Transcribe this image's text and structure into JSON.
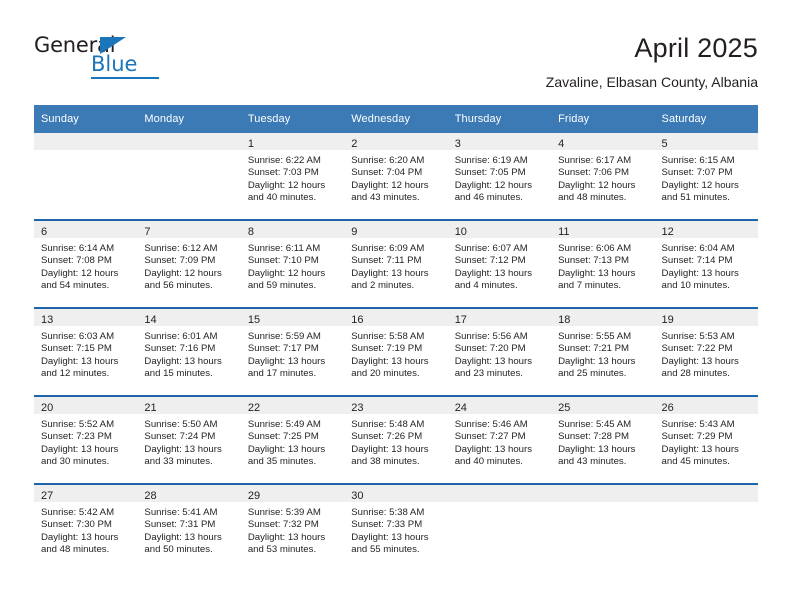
{
  "logo": {
    "word_top": "General",
    "word_bottom": "Blue",
    "triangle_icon": "triangle-icon",
    "brand_color": "#1b75bb"
  },
  "header": {
    "title": "April 2025",
    "subtitle": "Zavaline, Elbasan County, Albania"
  },
  "colors": {
    "header_blue": "#3b7ab5",
    "row_rule_blue": "#1f63a8",
    "daynum_band": "#efefef",
    "text": "#231f20"
  },
  "weekday_headers": [
    "Sunday",
    "Monday",
    "Tuesday",
    "Wednesday",
    "Thursday",
    "Friday",
    "Saturday"
  ],
  "weeks": [
    [
      {
        "day": "",
        "lines": []
      },
      {
        "day": "",
        "lines": []
      },
      {
        "day": "1",
        "lines": [
          "Sunrise: 6:22 AM",
          "Sunset: 7:03 PM",
          "Daylight: 12 hours",
          "and 40 minutes."
        ]
      },
      {
        "day": "2",
        "lines": [
          "Sunrise: 6:20 AM",
          "Sunset: 7:04 PM",
          "Daylight: 12 hours",
          "and 43 minutes."
        ]
      },
      {
        "day": "3",
        "lines": [
          "Sunrise: 6:19 AM",
          "Sunset: 7:05 PM",
          "Daylight: 12 hours",
          "and 46 minutes."
        ]
      },
      {
        "day": "4",
        "lines": [
          "Sunrise: 6:17 AM",
          "Sunset: 7:06 PM",
          "Daylight: 12 hours",
          "and 48 minutes."
        ]
      },
      {
        "day": "5",
        "lines": [
          "Sunrise: 6:15 AM",
          "Sunset: 7:07 PM",
          "Daylight: 12 hours",
          "and 51 minutes."
        ]
      }
    ],
    [
      {
        "day": "6",
        "lines": [
          "Sunrise: 6:14 AM",
          "Sunset: 7:08 PM",
          "Daylight: 12 hours",
          "and 54 minutes."
        ]
      },
      {
        "day": "7",
        "lines": [
          "Sunrise: 6:12 AM",
          "Sunset: 7:09 PM",
          "Daylight: 12 hours",
          "and 56 minutes."
        ]
      },
      {
        "day": "8",
        "lines": [
          "Sunrise: 6:11 AM",
          "Sunset: 7:10 PM",
          "Daylight: 12 hours",
          "and 59 minutes."
        ]
      },
      {
        "day": "9",
        "lines": [
          "Sunrise: 6:09 AM",
          "Sunset: 7:11 PM",
          "Daylight: 13 hours",
          "and 2 minutes."
        ]
      },
      {
        "day": "10",
        "lines": [
          "Sunrise: 6:07 AM",
          "Sunset: 7:12 PM",
          "Daylight: 13 hours",
          "and 4 minutes."
        ]
      },
      {
        "day": "11",
        "lines": [
          "Sunrise: 6:06 AM",
          "Sunset: 7:13 PM",
          "Daylight: 13 hours",
          "and 7 minutes."
        ]
      },
      {
        "day": "12",
        "lines": [
          "Sunrise: 6:04 AM",
          "Sunset: 7:14 PM",
          "Daylight: 13 hours",
          "and 10 minutes."
        ]
      }
    ],
    [
      {
        "day": "13",
        "lines": [
          "Sunrise: 6:03 AM",
          "Sunset: 7:15 PM",
          "Daylight: 13 hours",
          "and 12 minutes."
        ]
      },
      {
        "day": "14",
        "lines": [
          "Sunrise: 6:01 AM",
          "Sunset: 7:16 PM",
          "Daylight: 13 hours",
          "and 15 minutes."
        ]
      },
      {
        "day": "15",
        "lines": [
          "Sunrise: 5:59 AM",
          "Sunset: 7:17 PM",
          "Daylight: 13 hours",
          "and 17 minutes."
        ]
      },
      {
        "day": "16",
        "lines": [
          "Sunrise: 5:58 AM",
          "Sunset: 7:19 PM",
          "Daylight: 13 hours",
          "and 20 minutes."
        ]
      },
      {
        "day": "17",
        "lines": [
          "Sunrise: 5:56 AM",
          "Sunset: 7:20 PM",
          "Daylight: 13 hours",
          "and 23 minutes."
        ]
      },
      {
        "day": "18",
        "lines": [
          "Sunrise: 5:55 AM",
          "Sunset: 7:21 PM",
          "Daylight: 13 hours",
          "and 25 minutes."
        ]
      },
      {
        "day": "19",
        "lines": [
          "Sunrise: 5:53 AM",
          "Sunset: 7:22 PM",
          "Daylight: 13 hours",
          "and 28 minutes."
        ]
      }
    ],
    [
      {
        "day": "20",
        "lines": [
          "Sunrise: 5:52 AM",
          "Sunset: 7:23 PM",
          "Daylight: 13 hours",
          "and 30 minutes."
        ]
      },
      {
        "day": "21",
        "lines": [
          "Sunrise: 5:50 AM",
          "Sunset: 7:24 PM",
          "Daylight: 13 hours",
          "and 33 minutes."
        ]
      },
      {
        "day": "22",
        "lines": [
          "Sunrise: 5:49 AM",
          "Sunset: 7:25 PM",
          "Daylight: 13 hours",
          "and 35 minutes."
        ]
      },
      {
        "day": "23",
        "lines": [
          "Sunrise: 5:48 AM",
          "Sunset: 7:26 PM",
          "Daylight: 13 hours",
          "and 38 minutes."
        ]
      },
      {
        "day": "24",
        "lines": [
          "Sunrise: 5:46 AM",
          "Sunset: 7:27 PM",
          "Daylight: 13 hours",
          "and 40 minutes."
        ]
      },
      {
        "day": "25",
        "lines": [
          "Sunrise: 5:45 AM",
          "Sunset: 7:28 PM",
          "Daylight: 13 hours",
          "and 43 minutes."
        ]
      },
      {
        "day": "26",
        "lines": [
          "Sunrise: 5:43 AM",
          "Sunset: 7:29 PM",
          "Daylight: 13 hours",
          "and 45 minutes."
        ]
      }
    ],
    [
      {
        "day": "27",
        "lines": [
          "Sunrise: 5:42 AM",
          "Sunset: 7:30 PM",
          "Daylight: 13 hours",
          "and 48 minutes."
        ]
      },
      {
        "day": "28",
        "lines": [
          "Sunrise: 5:41 AM",
          "Sunset: 7:31 PM",
          "Daylight: 13 hours",
          "and 50 minutes."
        ]
      },
      {
        "day": "29",
        "lines": [
          "Sunrise: 5:39 AM",
          "Sunset: 7:32 PM",
          "Daylight: 13 hours",
          "and 53 minutes."
        ]
      },
      {
        "day": "30",
        "lines": [
          "Sunrise: 5:38 AM",
          "Sunset: 7:33 PM",
          "Daylight: 13 hours",
          "and 55 minutes."
        ]
      },
      {
        "day": "",
        "lines": []
      },
      {
        "day": "",
        "lines": []
      },
      {
        "day": "",
        "lines": []
      }
    ]
  ]
}
